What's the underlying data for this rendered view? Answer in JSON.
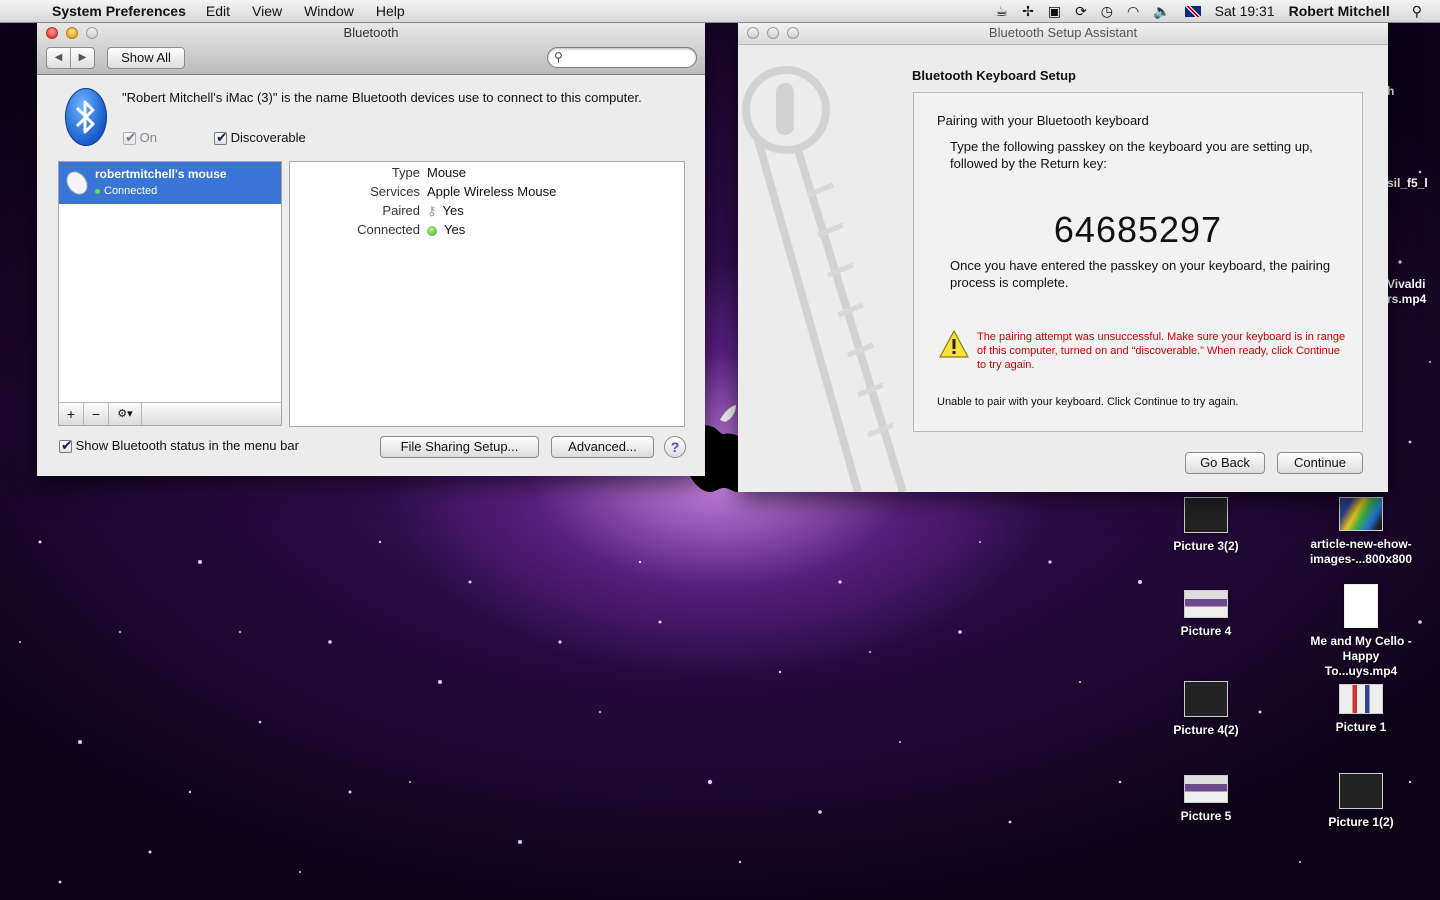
{
  "menubar": {
    "app_name": "System Preferences",
    "menus": [
      "Edit",
      "View",
      "Window",
      "Help"
    ],
    "clock": "Sat 19:31",
    "user": "Robert Mitchell"
  },
  "bt_window": {
    "title": "Bluetooth",
    "show_all": "Show All",
    "search_placeholder": "",
    "description": "\"Robert Mitchell's iMac (3)\" is the name Bluetooth devices use to connect to this computer.",
    "on_label": "On",
    "discoverable_label": "Discoverable",
    "device": {
      "name": "robertmitchell's mouse",
      "status": "Connected"
    },
    "details": [
      {
        "key": "Type",
        "value": "Mouse"
      },
      {
        "key": "Services",
        "value": "Apple Wireless Mouse"
      },
      {
        "key": "Paired",
        "value": "Yes"
      },
      {
        "key": "Connected",
        "value": "Yes"
      }
    ],
    "show_status_label": "Show Bluetooth status in the menu bar",
    "file_sharing_button": "File Sharing Setup...",
    "advanced_button": "Advanced...",
    "help_glyph": "?"
  },
  "setup_assistant": {
    "title": "Bluetooth Setup Assistant",
    "heading": "Bluetooth Keyboard Setup",
    "pairing_title": "Pairing with your Bluetooth keyboard",
    "instruction": "Type the following passkey on the keyboard you are setting up, followed by the Return key:",
    "passkey": "64685297",
    "after_text": "Once you have entered the passkey on your keyboard, the pairing process is complete.",
    "error_text": "The pairing attempt was unsuccessful. Make sure your keyboard is in range of this computer, turned on and “discoverable.” When ready, click Continue to try again.",
    "status_text": "Unable to pair with your keyboard. Click Continue to try again.",
    "go_back": "Go Back",
    "continue": "Continue"
  },
  "desktop": {
    "icons": [
      {
        "label": "Picture 3(2)"
      },
      {
        "label": "article-new-ehow-images-...800x800"
      },
      {
        "label": "Picture 4"
      },
      {
        "label": "Me and My Cello - Happy To...uys.mp4"
      },
      {
        "label": "Picture 4(2)"
      },
      {
        "label": "Picture 1"
      },
      {
        "label": "Picture 5"
      },
      {
        "label": "Picture 1(2)"
      }
    ],
    "partial_labels": [
      "h",
      "sil_f5_l",
      "Vivaldi",
      "rs.mp4"
    ]
  }
}
